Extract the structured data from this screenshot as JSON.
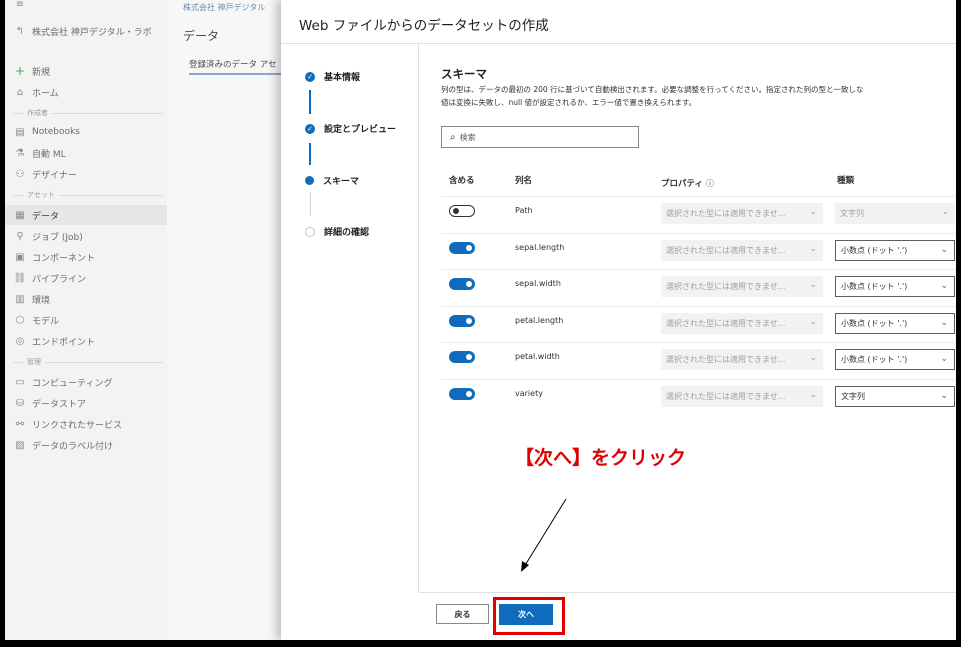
{
  "background": {
    "org_link": "株式会社 神戸デジタル・ラボ",
    "breadcrumb_org": "株式会社 神戸デジタル",
    "page_title": "データ",
    "tab": "登録済みのデータ アセ",
    "nav": {
      "new": "新規",
      "home": "ホーム",
      "section_author": "作成者",
      "notebooks": "Notebooks",
      "automl": "自動 ML",
      "designer": "デザイナー",
      "section_assets": "アセット",
      "data": "データ",
      "jobs": "ジョブ (Job)",
      "components": "コンポーネント",
      "pipelines": "パイプライン",
      "environments": "環境",
      "models": "モデル",
      "endpoints": "エンドポイント",
      "section_manage": "管理",
      "compute": "コンピューティング",
      "datastores": "データストア",
      "linked_services": "リンクされたサービス",
      "data_labeling": "データのラベル付け"
    }
  },
  "dialog": {
    "title": "Web ファイルからのデータセットの作成",
    "steps": [
      {
        "label": "基本情報",
        "state": "done"
      },
      {
        "label": "設定とプレビュー",
        "state": "done"
      },
      {
        "label": "スキーマ",
        "state": "current"
      },
      {
        "label": "詳細の確認",
        "state": "todo"
      }
    ],
    "schema": {
      "title": "スキーマ",
      "desc_line1": "列の型は、データの最初の 200 行に基づいて自動検出されます。必要な調整を行ってください。指定された列の型と一致しな",
      "desc_line2": "値は変換に失敗し、null 値が設定されるか、エラー値で置き換えられます。",
      "search_placeholder": "検索",
      "headers": {
        "include": "含める",
        "column": "列名",
        "properties": "プロパティ",
        "type": "種類"
      },
      "rows": [
        {
          "include": false,
          "name": "Path",
          "property": "選択された型には適用できませ...",
          "type": "文字列",
          "type_disabled": true
        },
        {
          "include": true,
          "name": "sepal.length",
          "property": "選択された型には適用できませ...",
          "type": "小数点 (ドット '.')",
          "type_disabled": false
        },
        {
          "include": true,
          "name": "sepal.width",
          "property": "選択された型には適用できませ...",
          "type": "小数点 (ドット '.')",
          "type_disabled": false
        },
        {
          "include": true,
          "name": "petal.length",
          "property": "選択された型には適用できませ...",
          "type": "小数点 (ドット '.')",
          "type_disabled": false
        },
        {
          "include": true,
          "name": "petal.width",
          "property": "選択された型には適用できませ...",
          "type": "小数点 (ドット '.')",
          "type_disabled": false
        },
        {
          "include": true,
          "name": "variety",
          "property": "選択された型には適用できませ...",
          "type": "文字列",
          "type_disabled": false
        }
      ]
    },
    "footer": {
      "back": "戻る",
      "next": "次へ"
    }
  },
  "annotation": {
    "text": "【次へ】をクリック",
    "color": "#e00000"
  },
  "colors": {
    "accent": "#0f6cbd",
    "highlight": "#e00000"
  }
}
